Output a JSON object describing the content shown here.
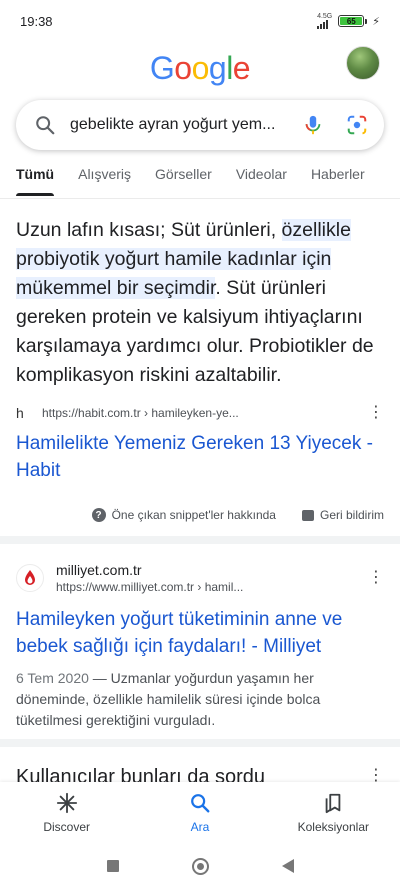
{
  "status_bar": {
    "time": "19:38",
    "network": "4.5G",
    "battery_level": "65"
  },
  "logo": {
    "letters": [
      "G",
      "o",
      "o",
      "g",
      "l",
      "e"
    ],
    "colors": [
      "#4285f4",
      "#ea4335",
      "#fbbc05",
      "#4285f4",
      "#34a853",
      "#ea4335"
    ]
  },
  "search": {
    "query": "gebelikte ayran yoğurt yem..."
  },
  "tabs": [
    {
      "label": "Tümü",
      "active": true
    },
    {
      "label": "Alışveriş"
    },
    {
      "label": "Görseller"
    },
    {
      "label": "Videolar"
    },
    {
      "label": "Haberler"
    }
  ],
  "featured_snippet": {
    "text_before": "Uzun lafın kısası; Süt ürünleri, ",
    "text_highlight": "özellikle probiyotik yoğurt hamile kadınlar için mükemmel bir seçimdir",
    "text_after": ". Süt ürünleri gereken protein ve kalsiyum ihtiyaçlarını karşılamaya yardımcı olur. Probiotikler de komplikasyon riskini azaltabilir.",
    "favicon": "h",
    "source_url": "https://habit.com.tr › hamileyken-ye...",
    "title": "Hamilelikte Yemeniz Gereken 13 Yiyecek - Habit",
    "about_label": "Öne çıkan snippet'ler hakkında",
    "feedback_label": "Geri bildirim"
  },
  "result2": {
    "site_name": "milliyet.com.tr",
    "url": "https://www.milliyet.com.tr › hamil...",
    "title": "Hamileyken yoğurt tüketiminin anne ve bebek sağlığı için faydaları! - Milliyet",
    "date": "6 Tem 2020",
    "description": " — Uzmanlar yoğurdun yaşamın her döneminde, özellikle hamilelik süresi içinde bolca tüketilmesi gerektiğini vurguladı."
  },
  "people_also_ask": {
    "title": "Kullanıcılar bunları da sordu"
  },
  "bottom_nav": [
    {
      "label": "Discover",
      "icon": "asterisk-icon"
    },
    {
      "label": "Ara",
      "icon": "search-icon",
      "active": true
    },
    {
      "label": "Koleksiyonlar",
      "icon": "collections-icon"
    }
  ],
  "colors": {
    "link": "#1a57d1",
    "accent": "#1a73e8",
    "highlight": "#e8f0fe"
  }
}
